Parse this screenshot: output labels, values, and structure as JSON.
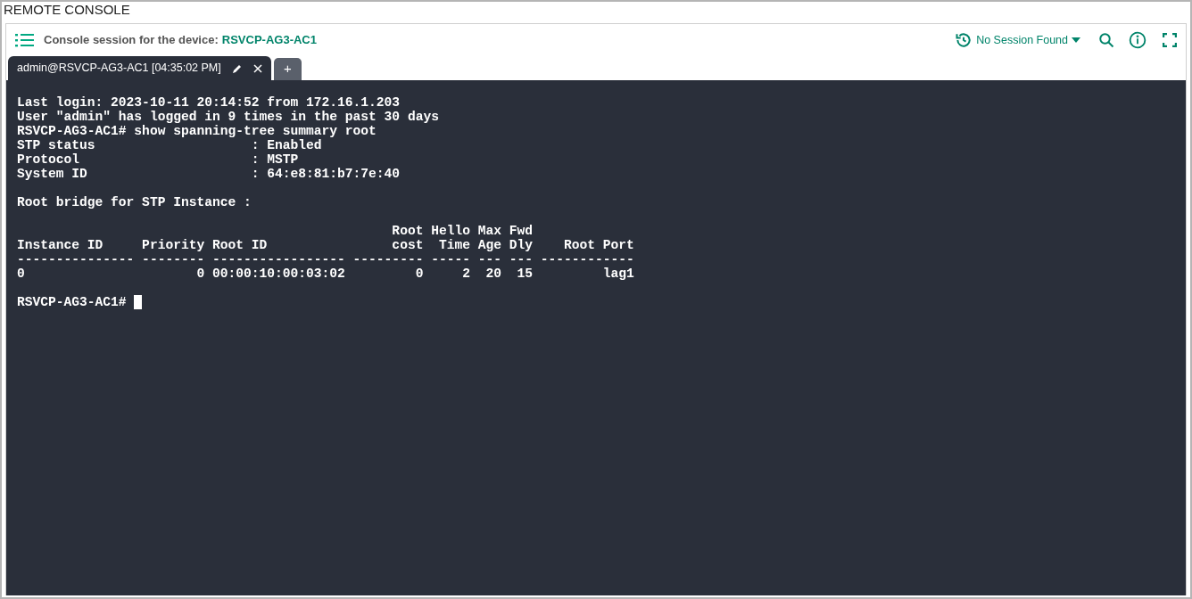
{
  "window": {
    "title": "REMOTE CONSOLE"
  },
  "header": {
    "label": "Console session for the device:",
    "device": "RSVCP-AG3-AC1",
    "session_dropdown": "No Session Found"
  },
  "tabs": [
    {
      "label": "admin@RSVCP-AG3-AC1 [04:35:02 PM]",
      "selected": true
    }
  ],
  "add_tab": "+",
  "terminal": {
    "blocks": [
      [
        "Last login: 2023-10-11 20:14:52 from 172.16.1.203",
        "User \"admin\" has logged in 9 times in the past 30 days",
        "RSVCP-AG3-AC1# show spanning-tree summary root",
        "STP status                    : Enabled",
        "Protocol                      : MSTP",
        "System ID                     : 64:e8:81:b7:7e:40"
      ],
      [
        "Root bridge for STP Instance :"
      ],
      [
        "                                                Root Hello Max Fwd",
        "Instance ID     Priority Root ID                cost  Time Age Dly    Root Port",
        "--------------- -------- ----------------- --------- ----- --- --- ------------",
        "0                      0 00:00:10:00:03:02         0     2  20  15         lag1"
      ]
    ],
    "prompt": "RSVCP-AG3-AC1# "
  }
}
